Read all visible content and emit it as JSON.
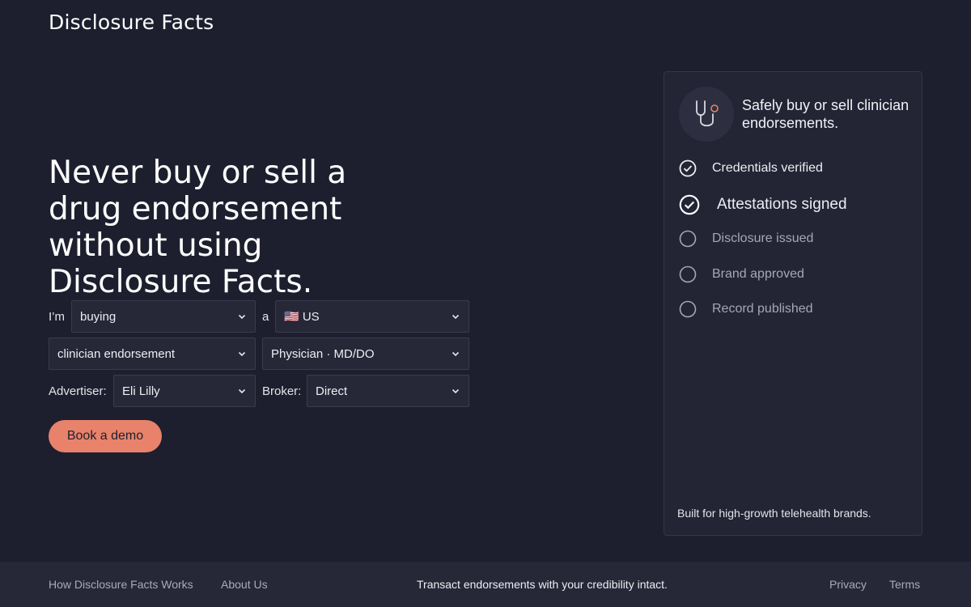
{
  "brand": {
    "logo": "Disclosure Facts"
  },
  "hero": {
    "headline": "Never buy or sell a drug endorsement without using Disclosure Facts."
  },
  "form": {
    "im_label": "I’m",
    "mode": "buying",
    "a_label": "a",
    "country": "🇺🇸 US",
    "type": "clinician endorsement",
    "credential": "Physician · MD/DO",
    "advertiser_label": "Advertiser:",
    "advertiser": "Eli Lilly",
    "broker_label": "Broker:",
    "broker": "Direct"
  },
  "cta": {
    "book_demo": "Book a demo"
  },
  "card": {
    "icon": "stethoscope-icon",
    "title": "Safely buy or sell clinician endorsements.",
    "steps": [
      {
        "label": "Credentials verified",
        "done": true
      },
      {
        "label": "Attestations signed",
        "done": true
      },
      {
        "label": "Disclosure issued",
        "done": false
      },
      {
        "label": "Brand approved",
        "done": false
      },
      {
        "label": "Record published",
        "done": false
      }
    ],
    "footer": "Built for high-growth telehealth brands."
  },
  "footer": {
    "how_it_works": "How Disclosure Facts Works",
    "about": "About Us",
    "tagline": "Transact endorsements with your credibility intact.",
    "privacy": "Privacy",
    "terms": "Terms"
  },
  "colors": {
    "background": "#1d1f2e",
    "accent": "#e8826a",
    "panel": "#232535"
  }
}
